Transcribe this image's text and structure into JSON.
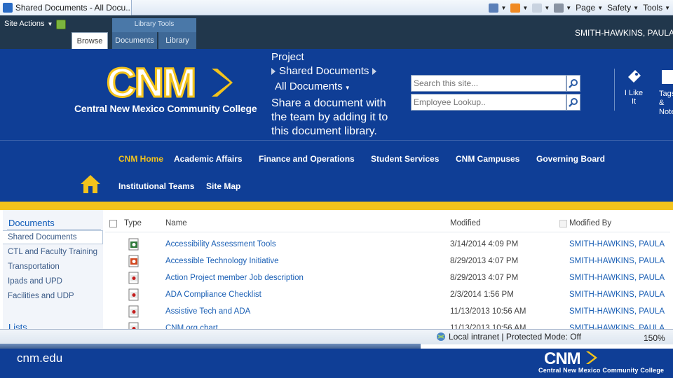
{
  "browser": {
    "tab_title": "Shared Documents - All Docu...",
    "commands": [
      {
        "label": "Page",
        "icon": "page-icon"
      },
      {
        "label": "Safety",
        "icon": "safety-icon"
      },
      {
        "label": "Tools",
        "icon": "tools-icon"
      }
    ],
    "icons": [
      "home-icon",
      "rss-feed-icon",
      "read-mail-icon",
      "print-icon"
    ]
  },
  "ribbon": {
    "site_actions": "Site Actions",
    "tab_group": "Library Tools",
    "tabs": [
      {
        "label": "Browse"
      },
      {
        "label": "Documents"
      },
      {
        "label": "Library"
      }
    ],
    "user": "SMITH-HAWKINS, PAULA"
  },
  "header": {
    "logo_text": "CNM",
    "college_name": "Central New Mexico Community College",
    "breadcrumb": [
      "Project",
      "Shared Documents",
      "All Documents"
    ],
    "description": "Share a document with the team by adding it to this document library.",
    "search_placeholder": "Search this site...",
    "employee_placeholder": "Employee Lookup..",
    "i_like_it": "I Like It",
    "tags_notes": "Tags & Notes",
    "colors": {
      "brand_blue": "#0f3e96",
      "brand_yellow": "#f3c31c"
    }
  },
  "nav": {
    "row1": [
      "CNM Home",
      "Academic Affairs",
      "Finance and Operations",
      "Student Services",
      "CNM Campuses",
      "Governing Board"
    ],
    "row2": [
      "Institutional Teams",
      "Site Map"
    ]
  },
  "quicklaunch": {
    "title": "Documents",
    "items": [
      "Shared Documents",
      "CTL and Faculty Training",
      "Transportation",
      "Ipads and UPD",
      "Facilities and UDP"
    ],
    "lists_title": "Lists"
  },
  "library": {
    "columns": [
      "Type",
      "Name",
      "Modified",
      "Modified By"
    ],
    "rows": [
      {
        "type": "excel",
        "name": "Accessibility Assessment Tools",
        "modified": "3/14/2014 4:09 PM",
        "by": "SMITH-HAWKINS, PAULA"
      },
      {
        "type": "powerpoint",
        "name": "Accessible Technology Initiative",
        "modified": "8/29/2013 4:07 PM",
        "by": "SMITH-HAWKINS, PAULA"
      },
      {
        "type": "pdf",
        "name": "Action Project member Job description",
        "modified": "8/29/2013 4:07 PM",
        "by": "SMITH-HAWKINS, PAULA"
      },
      {
        "type": "pdf",
        "name": "ADA Compliance Checklist",
        "modified": "2/3/2014 1:56 PM",
        "by": "SMITH-HAWKINS, PAULA"
      },
      {
        "type": "pdf",
        "name": "Assistive Tech and ADA",
        "modified": "11/13/2013 10:56 AM",
        "by": "SMITH-HAWKINS, PAULA"
      },
      {
        "type": "pdf",
        "name": "CNM org chart",
        "modified": "11/13/2013 10:56 AM",
        "by": "SMITH-HAWKINS, PAULA"
      }
    ]
  },
  "status": {
    "zone": "Local intranet | Protected Mode: Off",
    "zoom": "150%"
  },
  "footer": {
    "url": "cnm.edu",
    "logo_text": "CNM",
    "college_name": "Central New Mexico Community College"
  }
}
